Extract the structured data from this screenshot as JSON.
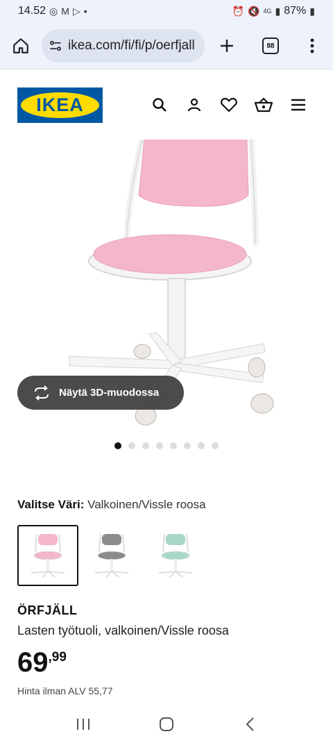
{
  "status": {
    "time": "14.52",
    "battery": "87%",
    "network": "4G"
  },
  "browser": {
    "url": "ikea.com/fi/fi/p/oerfjall",
    "tab_count": "88"
  },
  "header": {
    "logo_text": "IKEA"
  },
  "gallery": {
    "view_3d_label": "Näytä 3D-muodossa",
    "dots_total": 8,
    "active_index": 0
  },
  "color": {
    "label": "Valitse Väri:",
    "value": "Valkoinen/Vissle roosa",
    "options": [
      {
        "name": "pink",
        "seat": "#f4b6cd",
        "selected": true
      },
      {
        "name": "grey",
        "seat": "#8c8c8c",
        "selected": false
      },
      {
        "name": "green",
        "seat": "#a8d9c6",
        "selected": false
      }
    ]
  },
  "product": {
    "name": "ÖRFJÄLL",
    "description": "Lasten työtuoli, valkoinen/Vissle roosa",
    "price_int": "69",
    "price_dec": ",99",
    "vat_text": "Hinta ilman ALV 55,77"
  },
  "colors": {
    "ikea_blue": "#0058a3",
    "ikea_yellow": "#ffdb00",
    "chair_pink": "#f4b6cd"
  }
}
